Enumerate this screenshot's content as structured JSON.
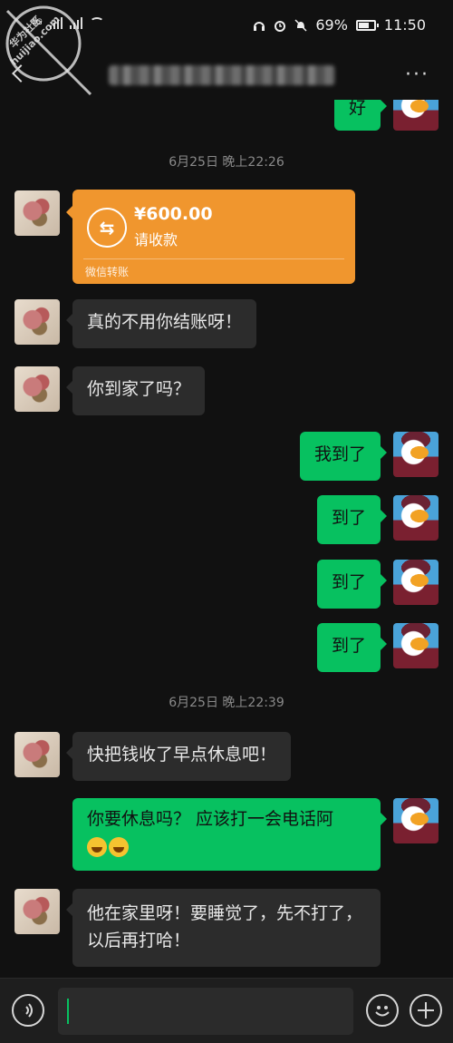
{
  "status_bar": {
    "network": "4G",
    "battery_percent": "69%",
    "battery_level": 0.69,
    "time": "11:50"
  },
  "watermark": {
    "line1": "华为社区",
    "line2": "huijiao.com"
  },
  "header": {
    "more_label": "···"
  },
  "messages": {
    "m0": {
      "text": "好"
    },
    "time1": "6月25日 晚上22:26",
    "transfer": {
      "amount": "¥600.00",
      "note": "请收款",
      "footer": "微信转账",
      "icon": "⇆"
    },
    "m2": {
      "text": "真的不用你结账呀！"
    },
    "m3": {
      "text": "你到家了吗？"
    },
    "m4": {
      "text": "我到了"
    },
    "m5": {
      "text": "到了"
    },
    "m6": {
      "text": "到了"
    },
    "m7": {
      "text": "到了"
    },
    "time2": "6月25日 晚上22:39",
    "m8": {
      "text": "快把钱收了早点休息吧！"
    },
    "m9": {
      "text": "你要休息吗？ 应该打一会电话阿"
    },
    "m10": {
      "text": "他在家里呀！要睡觉了，先不打了，以后再打哈！"
    }
  },
  "colors": {
    "outgoing": "#07c160",
    "incoming": "#2c2c2c",
    "transfer": "#f0962e",
    "background": "#111111"
  },
  "icons": {
    "voice": "voice-icon",
    "emoji": "emoji-icon",
    "plus": "plus-icon"
  }
}
